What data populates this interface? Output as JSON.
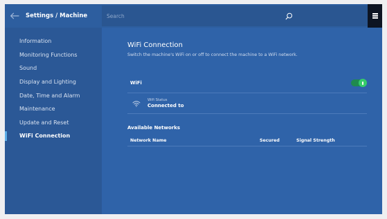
{
  "header": {
    "breadcrumb": "Settings / Machine",
    "search_placeholder": "Search"
  },
  "icons": {
    "back": "arrow-left-icon",
    "search": "search-icon",
    "menu": "hamburger-menu-icon",
    "wifi": "wifi-icon"
  },
  "sidebar": {
    "items": [
      {
        "label": "Information"
      },
      {
        "label": "Monitoring Functions"
      },
      {
        "label": "Sound"
      },
      {
        "label": "Display and Lighting"
      },
      {
        "label": "Date, Time and Alarm"
      },
      {
        "label": "Maintenance"
      },
      {
        "label": "Update and Reset"
      },
      {
        "label": "WiFi Connection",
        "active": true
      }
    ]
  },
  "main": {
    "title": "WiFi Connection",
    "subtitle": "Switch the machine's WiFi on or off to connect the machine to a WiFi network.",
    "wifi_label": "WiFi",
    "wifi_enabled": true,
    "status_caption": "Wifi Status",
    "status_value": "Connected to",
    "available_title": "Available Networks",
    "columns": [
      "Network Name",
      "Secured",
      "Signal Strength"
    ]
  },
  "colors": {
    "app_bg": "#2f63a9",
    "sidebar_bg": "#2b5896",
    "active_indicator": "#5eaee8",
    "toggle_on": "#36cc6a",
    "menu_button_bg": "#0d1422"
  }
}
